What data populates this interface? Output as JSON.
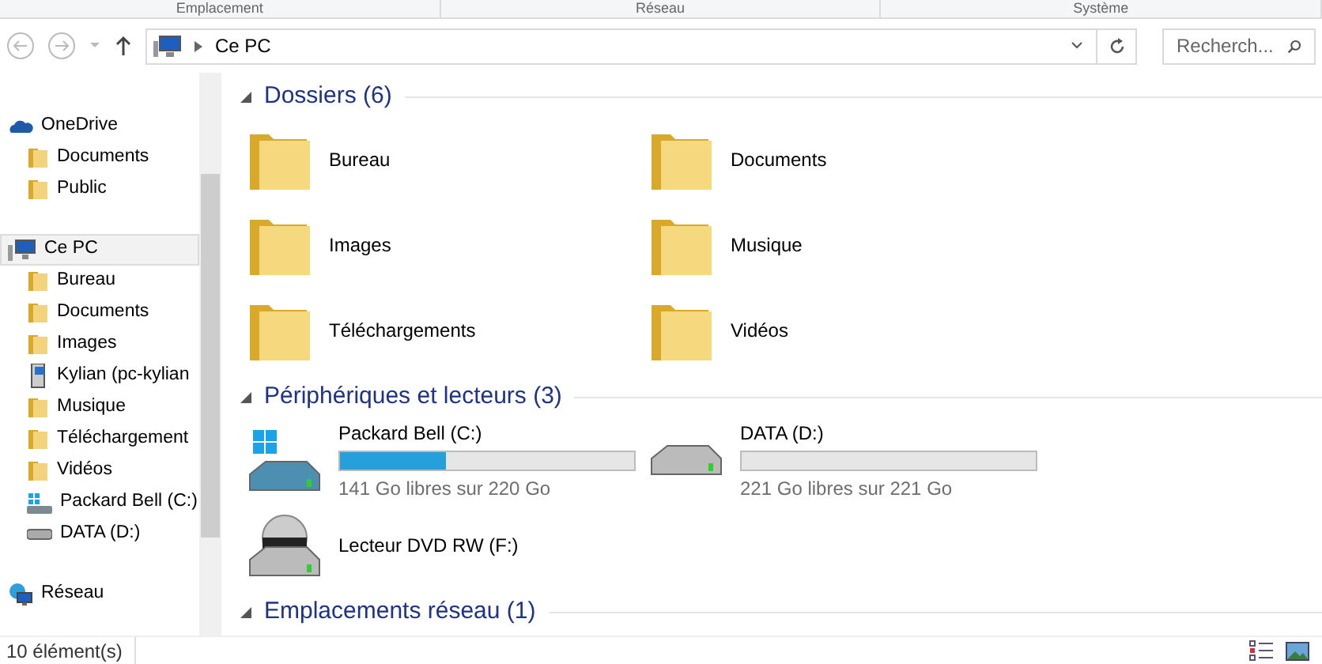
{
  "ribbon_groups": [
    "Emplacement",
    "Réseau",
    "Système"
  ],
  "address_bar": {
    "path": "Ce PC",
    "search_placeholder": "Recherch..."
  },
  "sidebar": {
    "items": [
      {
        "label": "OneDrive",
        "kind": "cloud",
        "selected": false,
        "children": [
          {
            "label": "Documents",
            "kind": "folder",
            "selected": false
          },
          {
            "label": "Public",
            "kind": "folder",
            "selected": false
          }
        ]
      },
      {
        "label": "Ce PC",
        "kind": "pc",
        "selected": true,
        "children": [
          {
            "label": "Bureau",
            "kind": "folder",
            "selected": false
          },
          {
            "label": "Documents",
            "kind": "folder",
            "selected": false
          },
          {
            "label": "Images",
            "kind": "folder",
            "selected": false
          },
          {
            "label": "Kylian (pc-kylian",
            "kind": "netpc",
            "selected": false
          },
          {
            "label": "Musique",
            "kind": "folder",
            "selected": false
          },
          {
            "label": "Téléchargement",
            "kind": "folder",
            "selected": false
          },
          {
            "label": "Vidéos",
            "kind": "folder",
            "selected": false
          },
          {
            "label": "Packard Bell (C:)",
            "kind": "windrive",
            "selected": false
          },
          {
            "label": "DATA (D:)",
            "kind": "drive",
            "selected": false
          }
        ]
      },
      {
        "label": "Réseau",
        "kind": "network",
        "selected": false
      }
    ]
  },
  "sections": [
    {
      "title": "Dossiers (6)",
      "kind": "folders",
      "items": [
        {
          "label": "Bureau"
        },
        {
          "label": "Documents"
        },
        {
          "label": "Images"
        },
        {
          "label": "Musique"
        },
        {
          "label": "Téléchargements"
        },
        {
          "label": "Vidéos"
        }
      ]
    },
    {
      "title": "Périphériques et lecteurs (3)",
      "kind": "drives",
      "items": [
        {
          "label": "Packard Bell (C:)",
          "kind": "windrive",
          "level": 0.36,
          "free": "141 Go libres sur 220 Go"
        },
        {
          "label": "DATA (D:)",
          "kind": "drive",
          "level": 0.0,
          "free": "221 Go libres sur 221 Go"
        },
        {
          "label": "Lecteur DVD RW (F:)",
          "kind": "dvd"
        }
      ]
    },
    {
      "title": "Emplacements réseau (1)",
      "kind": "network"
    }
  ],
  "status_bar": {
    "count": "10 élément(s)"
  }
}
